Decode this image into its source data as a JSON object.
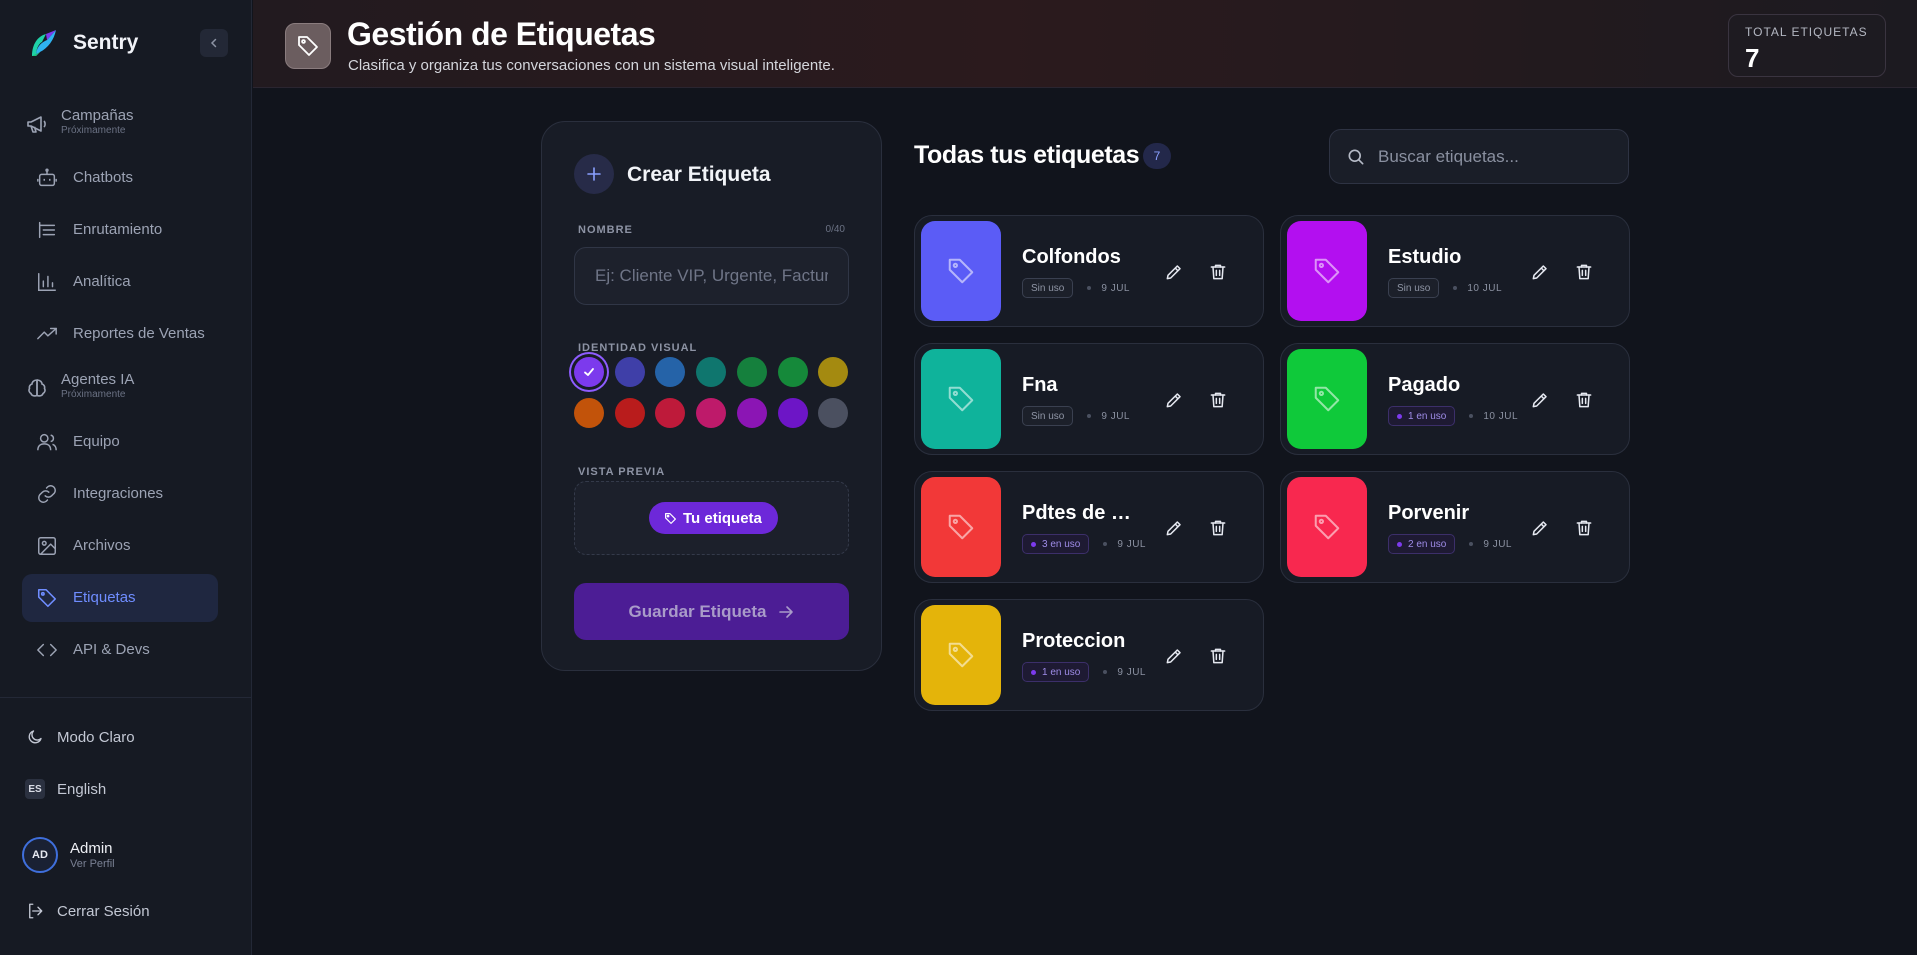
{
  "sidebar": {
    "brand": "Sentry",
    "items": [
      {
        "label": "Campañas",
        "sub": "Próximamente",
        "icon": "megaphone-icon"
      },
      {
        "label": "Chatbots",
        "icon": "bot-icon"
      },
      {
        "label": "Enrutamiento",
        "icon": "list-icon"
      },
      {
        "label": "Analítica",
        "icon": "bar-chart-icon"
      },
      {
        "label": "Reportes de Ventas",
        "icon": "trend-icon"
      },
      {
        "label": "Agentes IA",
        "sub": "Próximamente",
        "icon": "brain-icon"
      },
      {
        "label": "Equipo",
        "icon": "users-icon"
      },
      {
        "label": "Integraciones",
        "icon": "link-icon"
      },
      {
        "label": "Archivos",
        "icon": "image-icon"
      },
      {
        "label": "Etiquetas",
        "icon": "tag-icon",
        "active": true
      },
      {
        "label": "API & Devs",
        "icon": "code-icon"
      }
    ],
    "theme_label": "Modo Claro",
    "lang_code": "ES",
    "lang_label": "English",
    "profile": {
      "initials": "AD",
      "name": "Admin",
      "sub": "Ver Perfil"
    },
    "logout_label": "Cerrar Sesión"
  },
  "header": {
    "title": "Gestión de Etiquetas",
    "subtitle": "Clasifica y organiza tus conversaciones con un sistema visual inteligente.",
    "total_label": "TOTAL ETIQUETAS",
    "total_value": "7"
  },
  "create": {
    "title": "Crear Etiqueta",
    "name_label": "NOMBRE",
    "char_count": "0/40",
    "name_placeholder": "Ej: Cliente VIP, Urgente, Factura...",
    "identity_label": "IDENTIDAD VISUAL",
    "palette": [
      "#7c3aed",
      "#3f3fa8",
      "#2563a8",
      "#0f766e",
      "#15803d",
      "#15893a",
      "#a48a10",
      "#c2530a",
      "#b91c1c",
      "#be1a3a",
      "#be1a6a",
      "#8b15b4",
      "#6d15c6",
      "#4b5060"
    ],
    "selected_color": "#7c3aed",
    "preview_label": "VISTA PREVIA",
    "preview_chip": "Tu etiqueta",
    "save_label": "Guardar Etiqueta"
  },
  "list": {
    "title": "Todas tus etiquetas",
    "count": "7",
    "search_placeholder": "Buscar etiquetas...",
    "tags": [
      {
        "name": "Colfondos",
        "color": "#5b5cf6",
        "usage": "Sin uso",
        "used": false,
        "date": "9 JUL"
      },
      {
        "name": "Estudio",
        "color": "#b30ff0",
        "usage": "Sin uso",
        "used": false,
        "date": "10 JUL"
      },
      {
        "name": "Fna",
        "color": "#0fb39b",
        "usage": "Sin uso",
        "used": false,
        "date": "9 JUL"
      },
      {
        "name": "Pagado",
        "color": "#0fc93a",
        "usage": "1 en uso",
        "used": true,
        "date": "10 JUL"
      },
      {
        "name": "Pdtes de pago",
        "color": "#f23838",
        "usage": "3 en uso",
        "used": true,
        "date": "9 JUL"
      },
      {
        "name": "Porvenir",
        "color": "#f8284f",
        "usage": "2 en uso",
        "used": true,
        "date": "9 JUL"
      },
      {
        "name": "Proteccion",
        "color": "#e4b40a",
        "usage": "1 en uso",
        "used": true,
        "date": "9 JUL"
      }
    ]
  }
}
